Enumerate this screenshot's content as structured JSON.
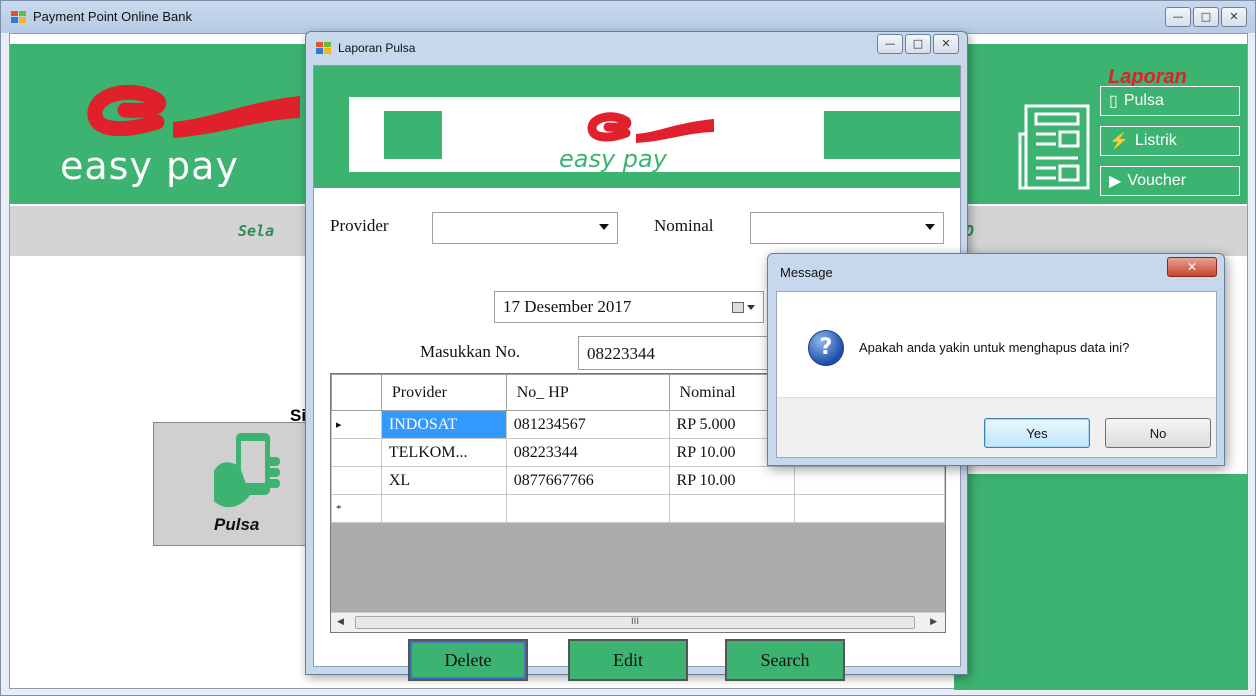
{
  "main_window": {
    "title": "Payment Point Online Bank",
    "logo_text": "easy pay",
    "marquee_left": "Sela",
    "marquee_right": "D",
    "laporan_heading": "Laporan",
    "laporan_buttons": [
      "Pulsa",
      "Listrik",
      "Voucher"
    ],
    "prompt_partial": "Sil",
    "tile_label": "Pulsa"
  },
  "laporan_window": {
    "title": "Laporan Pulsa",
    "logo_text": "easy pay",
    "provider_label": "Provider",
    "provider_value": "",
    "nominal_label": "Nominal",
    "nominal_value": "",
    "date_value": "17 Desember 2017",
    "masukkan_label": "Masukkan No.",
    "masukkan_value": "08223344",
    "grid": {
      "columns": [
        "Provider",
        "No_ HP",
        "Nominal"
      ],
      "rows": [
        {
          "marker": "▸",
          "provider": "INDOSAT",
          "no_hp": "081234567",
          "nominal": "RP 5.000"
        },
        {
          "marker": "",
          "provider": "TELKOM...",
          "no_hp": "08223344",
          "nominal": "RP 10.00"
        },
        {
          "marker": "",
          "provider": "XL",
          "no_hp": "0877667766",
          "nominal": "RP 10.00"
        },
        {
          "marker": "*",
          "provider": "",
          "no_hp": "",
          "nominal": ""
        }
      ],
      "scroll_thumb_label": "III"
    },
    "buttons": {
      "delete": "Delete",
      "edit": "Edit",
      "search": "Search"
    }
  },
  "message_box": {
    "title": "Message",
    "text": "Apakah anda yakin untuk menghapus data ini?",
    "yes_label": "Yes",
    "no_label": "No",
    "icon": "question-icon"
  },
  "colors": {
    "brand_green": "#3cb371",
    "brand_red": "#e0202a",
    "selection_blue": "#3399ff"
  }
}
